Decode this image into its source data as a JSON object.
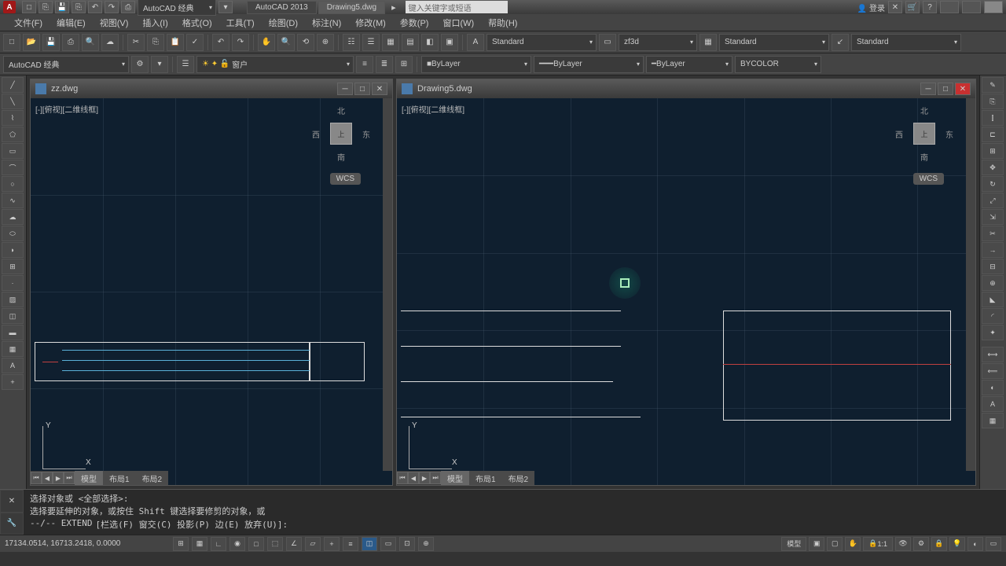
{
  "app": {
    "icon_letter": "A",
    "version_tab": "AutoCAD 2013",
    "drawing_tab": "Drawing5.dwg",
    "search_placeholder": "键入关键字或短语",
    "login": "登录"
  },
  "qa": {
    "workspace_combo": "AutoCAD 经典"
  },
  "menu": {
    "file": "文件(F)",
    "edit": "编辑(E)",
    "view": "视图(V)",
    "insert": "插入(I)",
    "format": "格式(O)",
    "tools": "工具(T)",
    "draw": "绘图(D)",
    "dimension": "标注(N)",
    "modify": "修改(M)",
    "parametric": "参数(P)",
    "window": "窗口(W)",
    "help": "帮助(H)"
  },
  "tb1": {
    "workspace": "AutoCAD 经典",
    "textstyle": "Standard",
    "dimstyle": "zf3d",
    "tablestyle": "Standard",
    "mleader": "Standard"
  },
  "tb2": {
    "layer_prop": "窗户",
    "layer_combo": "ByLayer",
    "ltype": "ByLayer",
    "lweight": "ByLayer",
    "color": "BYCOLOR"
  },
  "doc1": {
    "name": "zz.dwg",
    "viewlabel": "[-][俯视][二维线框]"
  },
  "doc2": {
    "name": "Drawing5.dwg",
    "viewlabel": "[-][俯视][二维线框]"
  },
  "compass": {
    "n": "北",
    "s": "南",
    "e": "东",
    "w": "西",
    "top": "上"
  },
  "wcs": "WCS",
  "ucs": {
    "x": "X",
    "y": "Y"
  },
  "layout": {
    "model": "模型",
    "l1": "布局1",
    "l2": "布局2"
  },
  "cmd": {
    "line1": "选择对象或 <全部选择>:",
    "line2": "选择要延伸的对象，或按住 Shift 键选择要修剪的对象，或",
    "prompt_prefix": "--/-- EXTEND",
    "prompt_rest": "[栏选(F) 窗交(C) 投影(P) 边(E) 放弃(U)]:"
  },
  "status": {
    "coords": "17134.0514, 16713.2418, 0.0000",
    "model": "模型",
    "scale": "1:1"
  }
}
